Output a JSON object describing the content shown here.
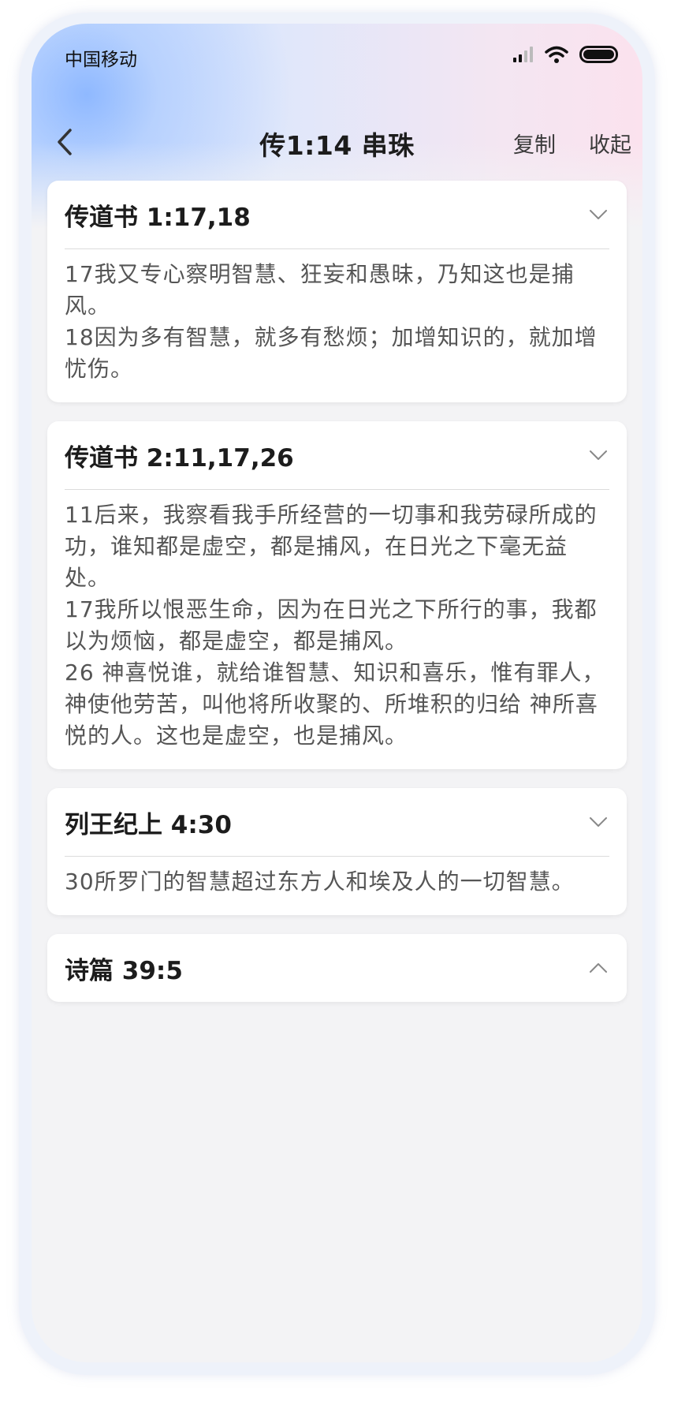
{
  "status_bar": {
    "carrier": "中国移动",
    "signal_icon": "cellular-signal-icon",
    "wifi_icon": "wifi-icon",
    "battery_icon": "battery-icon"
  },
  "nav": {
    "back_icon": "chevron-left-icon",
    "title": "传1:14 串珠",
    "copy_label": "复制",
    "collapse_label": "收起"
  },
  "colors": {
    "text_primary": "#1c1c1c",
    "text_body": "#555555",
    "card_bg": "#ffffff",
    "page_bg": "#f3f3f5"
  },
  "cards": [
    {
      "title": "传道书 1:17,18",
      "expanded": true,
      "icon": "chevron-down-icon",
      "verses": [
        "17我又专心察明智慧、狂妄和愚昧，乃知这也是捕风。",
        "18因为多有智慧，就多有愁烦；加增知识的，就加增忧伤。"
      ]
    },
    {
      "title": "传道书 2:11,17,26",
      "expanded": true,
      "icon": "chevron-down-icon",
      "verses": [
        "11后来，我察看我手所经营的一切事和我劳碌所成的功，谁知都是虚空，都是捕风，在日光之下毫无益处。",
        "17我所以恨恶生命，因为在日光之下所行的事，我都以为烦恼，都是虚空，都是捕风。",
        "26 神喜悦谁，就给谁智慧、知识和喜乐，惟有罪人， 神使他劳苦，叫他将所收聚的、所堆积的归给 神所喜悦的人。这也是虚空，也是捕风。"
      ]
    },
    {
      "title": "列王纪上 4:30",
      "expanded": true,
      "icon": "chevron-down-icon",
      "verses": [
        "30所罗门的智慧超过东方人和埃及人的一切智慧。"
      ]
    },
    {
      "title": "诗篇 39:5",
      "expanded": false,
      "icon": "chevron-up-icon",
      "verses": []
    }
  ]
}
